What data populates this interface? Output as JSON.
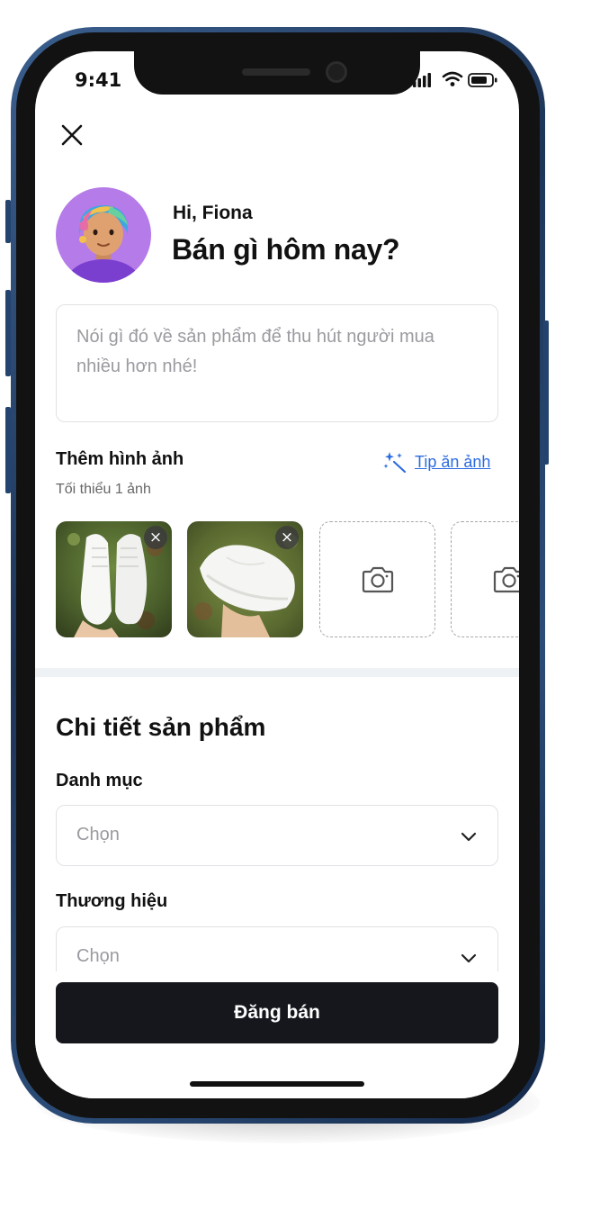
{
  "status_bar": {
    "time": "9:41"
  },
  "header": {
    "greeting": "Hi, Fiona",
    "headline": "Bán gì hôm nay?"
  },
  "description": {
    "placeholder": "Nói gì đó về sản phẩm để thu hút người mua nhiều hơn nhé!"
  },
  "photos": {
    "title": "Thêm hình ảnh",
    "subtitle": "Tối thiểu 1 ảnh",
    "tip_label": "Tip ăn ảnh",
    "remove_glyph": "×"
  },
  "details": {
    "title": "Chi tiết sản phẩm",
    "fields": [
      {
        "label": "Danh mục",
        "value": "Chọn"
      },
      {
        "label": "Thương hiệu",
        "value": "Chọn"
      }
    ]
  },
  "footer": {
    "submit_label": "Đăng bán"
  },
  "colors": {
    "primary": "#15171c",
    "link": "#2d6cdf",
    "avatar_bg": "#b57be8",
    "placeholder": "#9a9aa0"
  }
}
